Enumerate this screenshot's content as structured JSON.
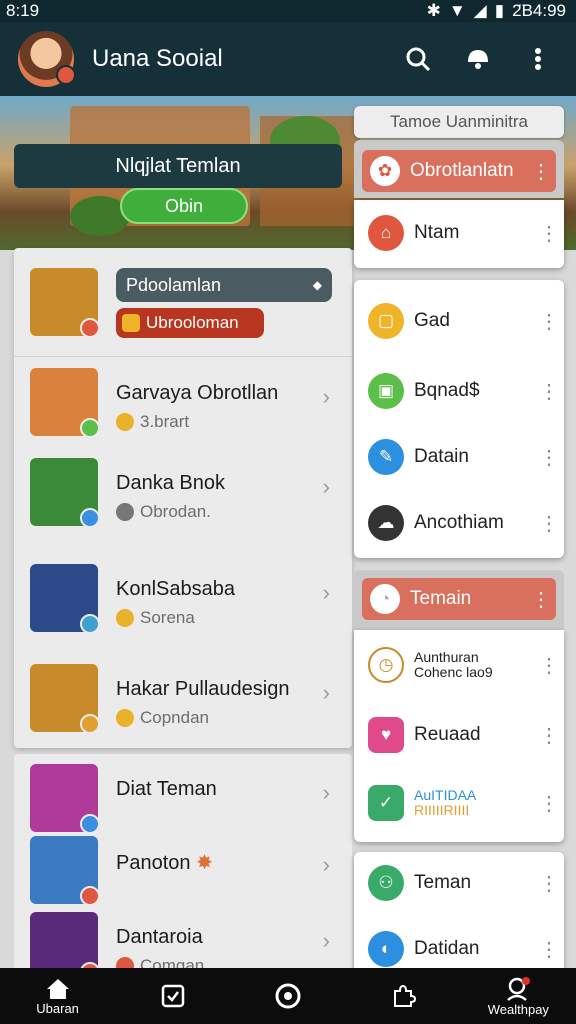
{
  "status": {
    "time": "8:19",
    "right_text": "2̈B4:99"
  },
  "appbar": {
    "title": "Uana Sooial"
  },
  "banner": {
    "card_text": "Nlqjlat Temlan",
    "button_label": "Obin"
  },
  "featured": {
    "pill_text": "Pdoolamlan",
    "tag_text": "Ubrooloman"
  },
  "friends": [
    {
      "name": "Garvaya Obrotllan",
      "sub": "3.brart",
      "badge_color": "#e8b32a",
      "pic_color": "#d9803a",
      "mini_color": "#5bbf4a"
    },
    {
      "name": "Danka Bnok",
      "sub": "Obrodan.",
      "badge_color": "#777777",
      "pic_color": "#3a8a3a",
      "mini_color": "#3b8fe0"
    },
    {
      "name": "KonlSabsaba",
      "sub": "Sorena",
      "badge_color": "#e8b32a",
      "pic_color": "#2c4a8a",
      "mini_color": "#3fa0d0"
    },
    {
      "name": "Hakar Pullaudesign",
      "sub": "Copndan",
      "badge_color": "#e8b32a",
      "pic_color": "#c98a2a",
      "mini_color": "#e0a030"
    }
  ],
  "friends2": [
    {
      "name": "Diat Teman",
      "sub": "",
      "pic_color": "#b03a9a",
      "mini_color": "#3b8fe0"
    },
    {
      "name": "Panoton",
      "sub": "",
      "pic_color": "#3a7ac0",
      "mini_color": "#e0573f"
    },
    {
      "name": "Dantaroia",
      "sub": "Comgan",
      "pic_color": "#5a2a7a",
      "mini_color": "#e0573f"
    }
  ],
  "menu": {
    "header": "Tamoe Uanminitra",
    "group1": [
      {
        "label": "Obrotlanlatn",
        "icon": "gift-icon",
        "color": "#e0573f",
        "highlight": true
      },
      {
        "label": "Ntam",
        "icon": "share-icon",
        "color": "#e0573f"
      }
    ],
    "group2": [
      {
        "label": "Gad",
        "icon": "chat-icon",
        "color": "#f0b429"
      },
      {
        "label": "Bqnad$",
        "icon": "trophy-icon",
        "color": "#5bbf4a"
      },
      {
        "label": "Datain",
        "icon": "edit-icon",
        "color": "#2d8fe0"
      },
      {
        "label": "Ancothiam",
        "icon": "cloud-icon",
        "color": "#333333"
      }
    ],
    "group3": [
      {
        "label": "Temain",
        "icon": "clock-icon",
        "color": "#ffffff",
        "highlight": true
      },
      {
        "label": "Aunthuran\nCohenc lao9",
        "icon": "timer-icon",
        "color": "#ffffff",
        "small": true
      },
      {
        "label": "Reuaad",
        "icon": "heart-icon",
        "color": "#e04a8a"
      },
      {
        "label": "AuITIDAA\nRIIIIIRIIII",
        "icon": "chart-icon",
        "color": "#3aaa6a",
        "small": true
      }
    ],
    "group4": [
      {
        "label": "Teman",
        "icon": "people-icon",
        "color": "#3aaa6a"
      },
      {
        "label": "Datidan",
        "icon": "share-icon",
        "color": "#2d8fe0"
      }
    ]
  },
  "nav": [
    {
      "label": "Ubaran",
      "icon": "home-icon"
    },
    {
      "label": "",
      "icon": "calendar-icon"
    },
    {
      "label": "",
      "icon": "compass-icon"
    },
    {
      "label": "",
      "icon": "puzzle-icon"
    },
    {
      "label": "Wealthpay",
      "icon": "profile-icon"
    }
  ]
}
